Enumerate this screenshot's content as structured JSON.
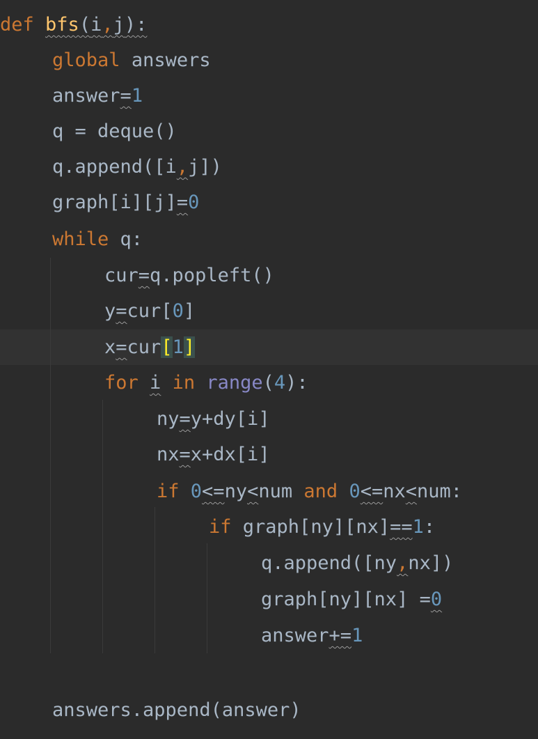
{
  "code": {
    "line1": {
      "kw": "def",
      "fn": "bfs",
      "open": "(",
      "a": "i",
      "sep": ",",
      "b": "j",
      "close": "):"
    },
    "line2": {
      "kw": "global",
      "name": "answers"
    },
    "line3": {
      "name": "answer",
      "op": "=",
      "num": "1"
    },
    "line4": {
      "text": "q = deque()"
    },
    "line5": {
      "pre": "q.append([i",
      "sep": ",",
      "post": "j])"
    },
    "line6": {
      "pre": "graph[i][j]",
      "op": "=",
      "num": "0"
    },
    "line7": {
      "kw": "while",
      "rest": " q:"
    },
    "line8": {
      "name": "cur",
      "op": "=",
      "rest": "q.popleft()"
    },
    "line9": {
      "name": "y",
      "op": "=",
      "pre": "cur[",
      "num": "0",
      "post": "]"
    },
    "line10": {
      "name": "x",
      "op": "=",
      "pre": "cur",
      "lb": "[",
      "num": "1",
      "rb": "]"
    },
    "line11": {
      "kw": "for",
      "var": "i",
      "kw2": "in",
      "fn": "range",
      "open": "(",
      "num": "4",
      "close": "):"
    },
    "line12": {
      "name": "ny",
      "op": "=",
      "rest": "y+dy[i]"
    },
    "line13": {
      "name": "nx",
      "op": "=",
      "rest": "x+dx[i]"
    },
    "line14": {
      "kw": "if",
      "num1": "0",
      "op1": "<=",
      "v1": "ny",
      "op2": "<",
      "v2": "num",
      "kw2": "and",
      "num2": "0",
      "op3": "<=",
      "v3": "nx",
      "op4": "<",
      "v4": "num:"
    },
    "line15": {
      "kw": "if",
      "pre": "graph[ny][nx]",
      "op": "==",
      "num": "1",
      "post": ":"
    },
    "line16": {
      "pre": "q.append([ny",
      "sep": ",",
      "post": "nx])"
    },
    "line17": {
      "pre": "graph[ny][nx] ",
      "op": "=",
      "num": "0"
    },
    "line18": {
      "name": "answer",
      "op": "+=",
      "num": "1"
    },
    "line20": {
      "text": "answers.append(answer)"
    }
  }
}
